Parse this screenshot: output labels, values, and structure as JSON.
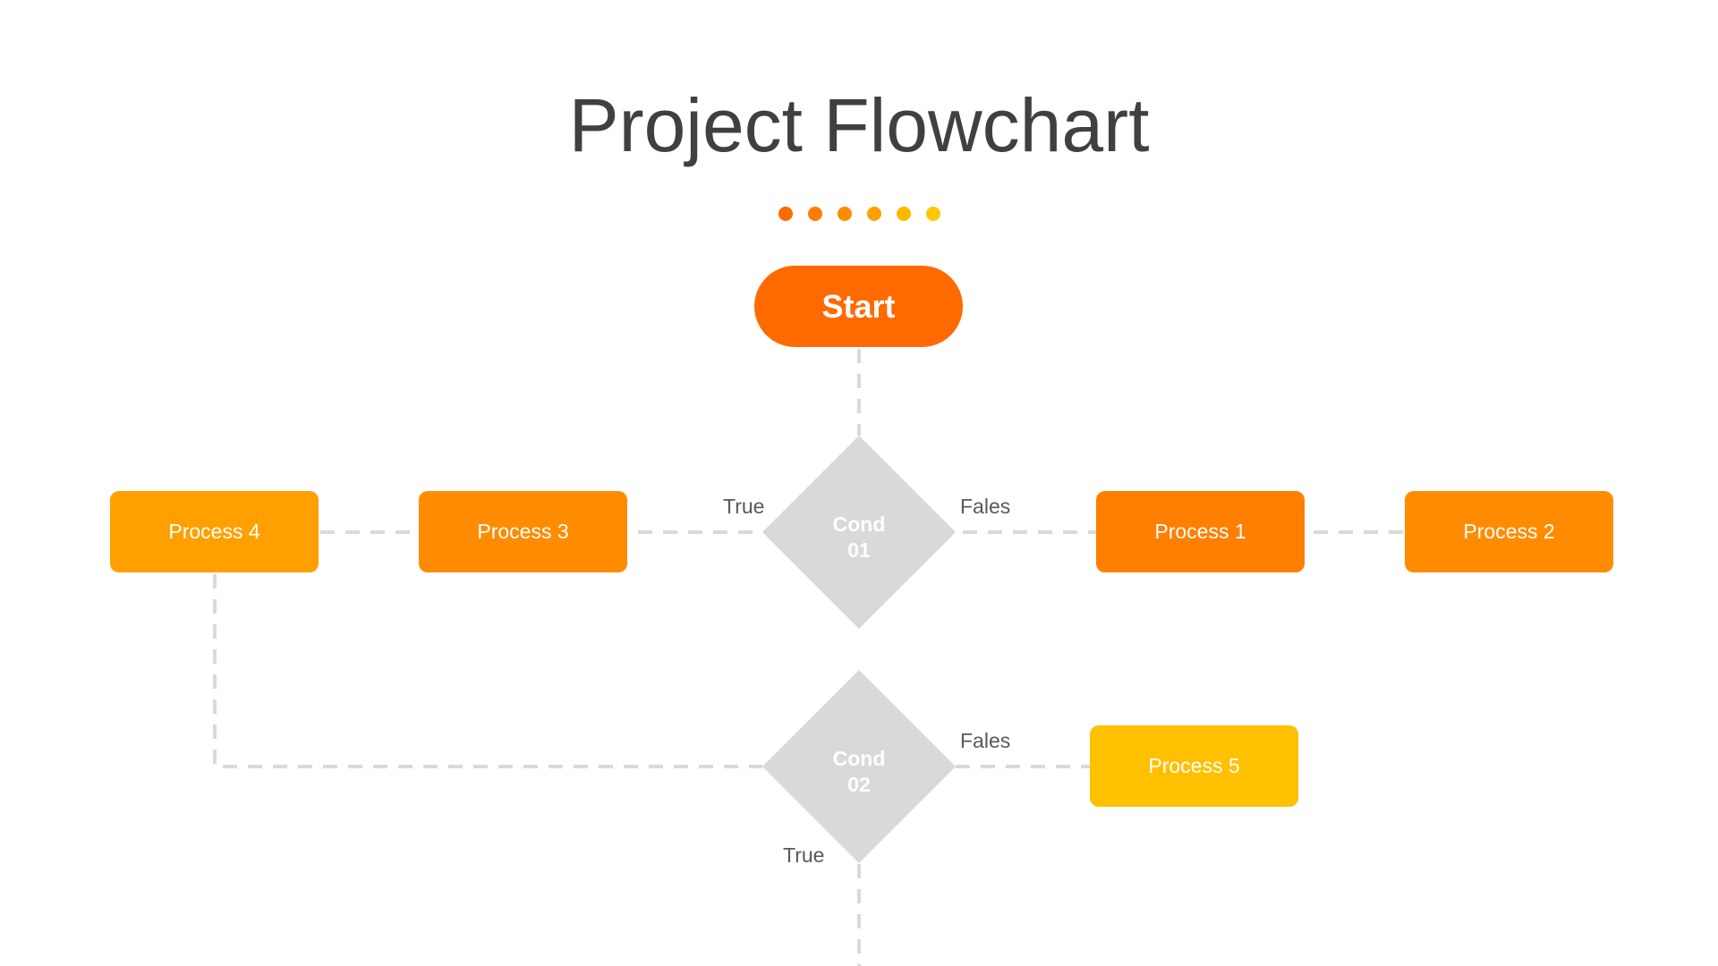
{
  "title": "Project Flowchart",
  "decoration_dots": [
    {
      "color": "#FF6A00"
    },
    {
      "color": "#FF7C00"
    },
    {
      "color": "#FF8C00"
    },
    {
      "color": "#FFA000"
    },
    {
      "color": "#FFB800"
    },
    {
      "color": "#FFC800"
    }
  ],
  "nodes": {
    "start": {
      "label": "Start",
      "color": "#FF6A00"
    },
    "cond01": {
      "line1": "Cond",
      "line2": "01",
      "color": "#D9D9D9"
    },
    "cond02": {
      "line1": "Cond",
      "line2": "02",
      "color": "#D9D9D9"
    },
    "process1": {
      "label": "Process 1",
      "color": "#FF7F00"
    },
    "process2": {
      "label": "Process 2",
      "color": "#FF8C00"
    },
    "process3": {
      "label": "Process 3",
      "color": "#FF8C00"
    },
    "process4": {
      "label": "Process 4",
      "color": "#FFA000"
    },
    "process5": {
      "label": "Process 5",
      "color": "#FFC000"
    }
  },
  "edge_labels": {
    "cond01_true": "True",
    "cond01_false": "Fales",
    "cond02_false": "Fales",
    "cond02_true": "True"
  },
  "connector_color": "#D9D9D9"
}
